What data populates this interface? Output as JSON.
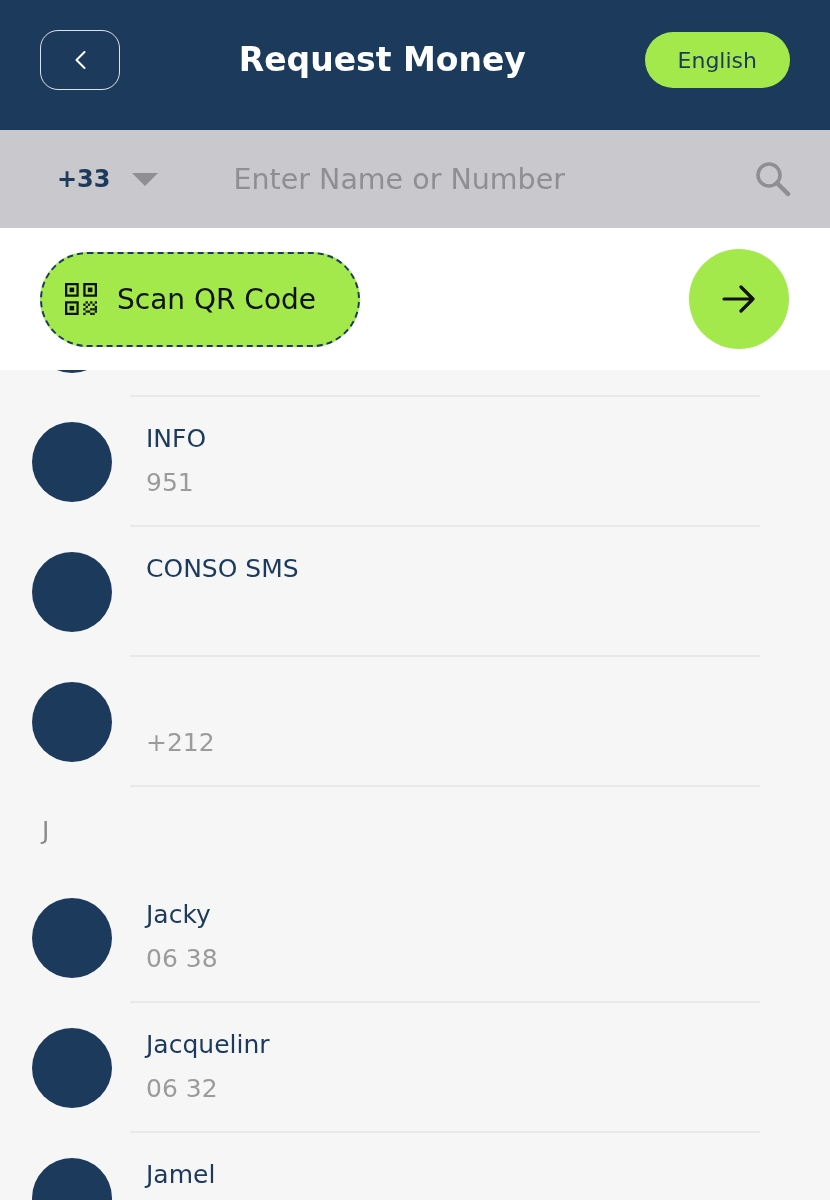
{
  "header": {
    "title": "Request Money",
    "language_button": "English"
  },
  "search": {
    "country_code": "+33",
    "placeholder": "Enter Name or Number"
  },
  "scan_button": {
    "label": "Scan QR Code"
  },
  "contacts": [
    {
      "kind": "contact_clipped"
    },
    {
      "kind": "contact",
      "name": "INFO",
      "number": "951"
    },
    {
      "kind": "contact",
      "name": "CONSO SMS"
    },
    {
      "kind": "contact",
      "number": "+212"
    },
    {
      "kind": "section",
      "letter": "J"
    },
    {
      "kind": "contact",
      "name": "Jacky",
      "number": "06 38"
    },
    {
      "kind": "contact",
      "name": "Jacquelinr",
      "number": "06 32"
    },
    {
      "kind": "contact",
      "name": "Jamel"
    }
  ]
}
